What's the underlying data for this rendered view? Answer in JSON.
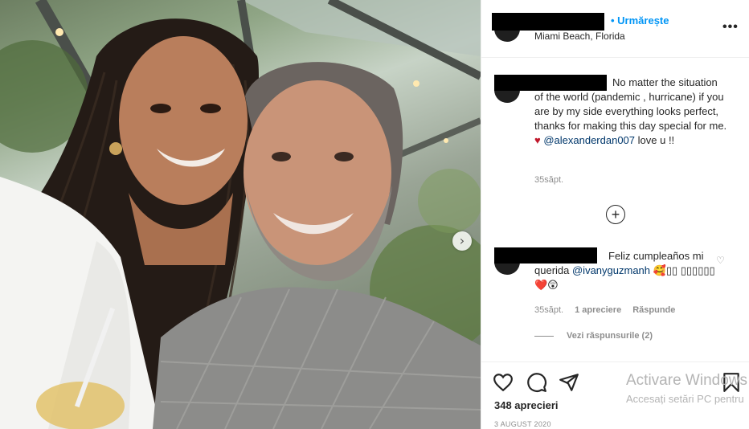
{
  "post": {
    "follow_label": "• Urmărește",
    "location": "Miami Beach, Florida",
    "more_label": "•••",
    "caption_text": "No matter the situation of the world (pandemic , hurricane) if you are by my side everything looks perfect, thanks for making this day special for me.",
    "caption_heart": "♥",
    "caption_mention": "@alexanderdan007",
    "caption_tail": " love u !!",
    "caption_age": "35săpt.",
    "load_more_icon": "plus-circle-icon",
    "load_more_label": "+"
  },
  "comment": {
    "text_start": "Feliz cumpleaños mi querida ",
    "mention": "@ivanyguzmanh",
    "emoji": " 🥰▯▯ ▯▯▯▯▯▯❤️😲",
    "age": "35săpt.",
    "likes": "1 apreciere",
    "reply_label": "Răspunde",
    "view_replies": "Vezi răspunsurile (2)",
    "like_icon": "♡"
  },
  "footer": {
    "likes": "348 aprecieri",
    "date": "3 AUGUST 2020"
  },
  "watermark": {
    "title": "Activare Windows",
    "subtitle": "Accesați setări PC pentru"
  },
  "photo": {
    "next_label": "›"
  },
  "colors": {
    "accent": "#0095f6",
    "heart": "#c0172b",
    "mention": "#00376b"
  }
}
